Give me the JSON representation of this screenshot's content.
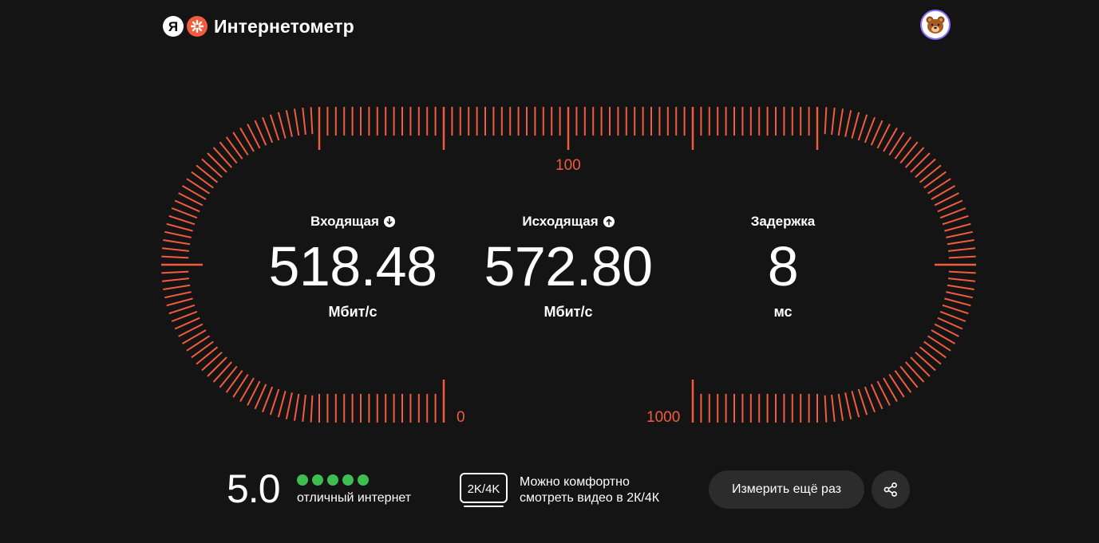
{
  "header": {
    "logo_letter": "Я",
    "title": "Интернетометр"
  },
  "gauge": {
    "scale_labels": {
      "top": "100",
      "bottom_left": "0",
      "bottom_right": "1000"
    },
    "accent_color": "#f25b3d"
  },
  "metrics": [
    {
      "title": "Входящая",
      "icon": "arrow-down-icon",
      "value": "518.48",
      "unit": "Мбит/с"
    },
    {
      "title": "Исходящая",
      "icon": "arrow-up-icon",
      "value": "572.80",
      "unit": "Мбит/с"
    },
    {
      "title": "Задержка",
      "icon": "",
      "value": "8",
      "unit": "мс"
    }
  ],
  "rating": {
    "score": "5.0",
    "dots_filled": 5,
    "dots_total": 5,
    "label": "отличный интернет",
    "dot_color": "#3dbe4f"
  },
  "video": {
    "badge": "2K/4K",
    "line1": "Можно комфортно",
    "line2": "смотреть видео в 2К/4К"
  },
  "actions": {
    "retest_label": "Измерить ещё раз",
    "share_icon": "share-icon"
  },
  "colors": {
    "background": "#141414",
    "accent": "#f25b3d",
    "button_bg": "#2c2c2c",
    "avatar_ring": "#8f6bff"
  }
}
